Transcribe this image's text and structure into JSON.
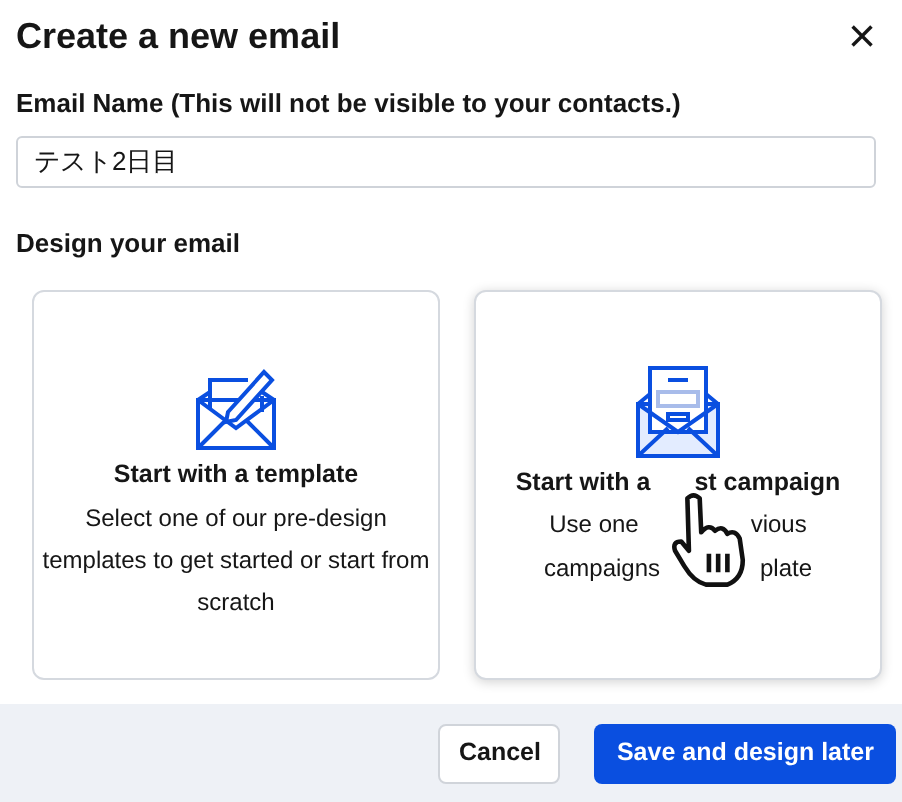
{
  "dialog": {
    "title": "Create a new email",
    "close": "×"
  },
  "email_name": {
    "label": "Email Name (This will not be visible to your contacts.)",
    "value": "テスト2日目"
  },
  "design_label": "Design your email",
  "cards": [
    {
      "kind": "template",
      "hovered": false,
      "title": [
        "Start with a template"
      ],
      "text": [
        [
          "Select one of our pre-design templates to get started or start from scratch"
        ]
      ]
    },
    {
      "kind": "campaign",
      "hovered": true,
      "title": [
        "Start with a",
        "st campaign"
      ],
      "text": [
        [
          "Use one",
          "vious"
        ],
        [
          "campaigns",
          "plate"
        ]
      ]
    }
  ],
  "buttons": [
    {
      "label": "Cancel",
      "kind": "secondary"
    },
    {
      "label": "Save and design later",
      "kind": "primary"
    }
  ]
}
